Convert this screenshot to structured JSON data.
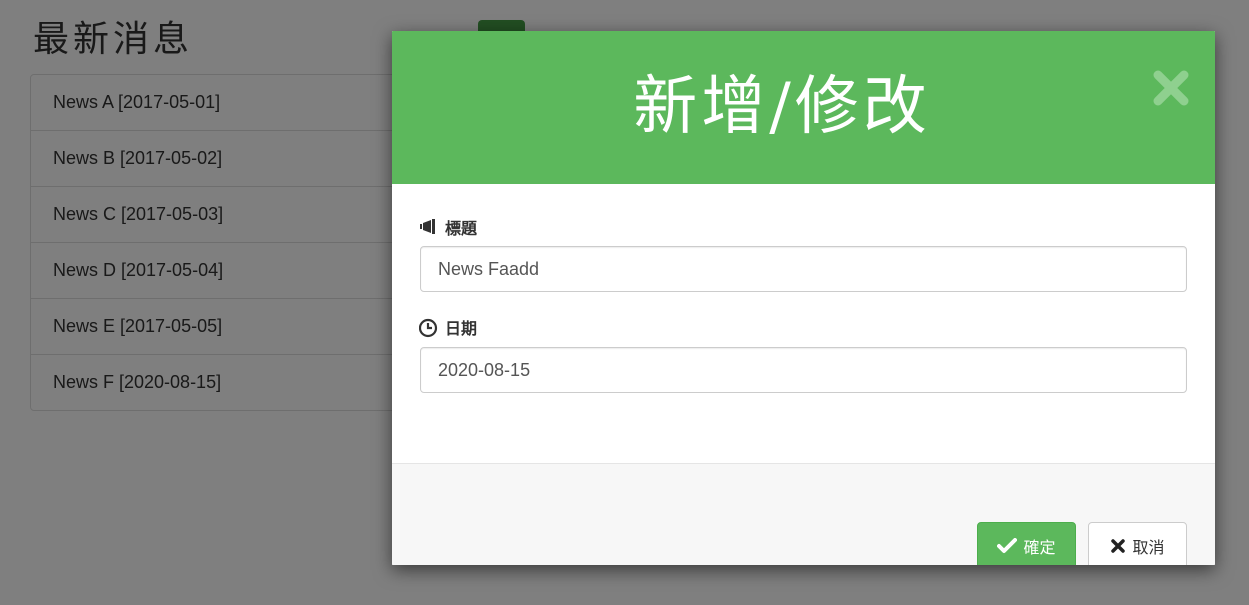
{
  "page": {
    "title": "最新消息"
  },
  "news_list": [
    {
      "label": "News A [2017-05-01]"
    },
    {
      "label": "News B [2017-05-02]"
    },
    {
      "label": "News C [2017-05-03]"
    },
    {
      "label": "News D [2017-05-04]"
    },
    {
      "label": "News E [2017-05-05]"
    },
    {
      "label": "News F [2020-08-15]"
    }
  ],
  "modal": {
    "title": "新增/修改",
    "close_icon": "close-icon",
    "fields": {
      "title": {
        "label": "標題",
        "icon": "bullhorn-icon",
        "value": "News Faadd"
      },
      "date": {
        "label": "日期",
        "icon": "clock-icon",
        "value": "2020-08-15"
      }
    },
    "buttons": {
      "confirm": {
        "label": "確定",
        "icon": "check-icon"
      },
      "cancel": {
        "label": "取消",
        "icon": "times-icon"
      }
    }
  },
  "colors": {
    "primary_green": "#5cb85c",
    "backdrop": "rgba(0,0,0,0.5)"
  }
}
